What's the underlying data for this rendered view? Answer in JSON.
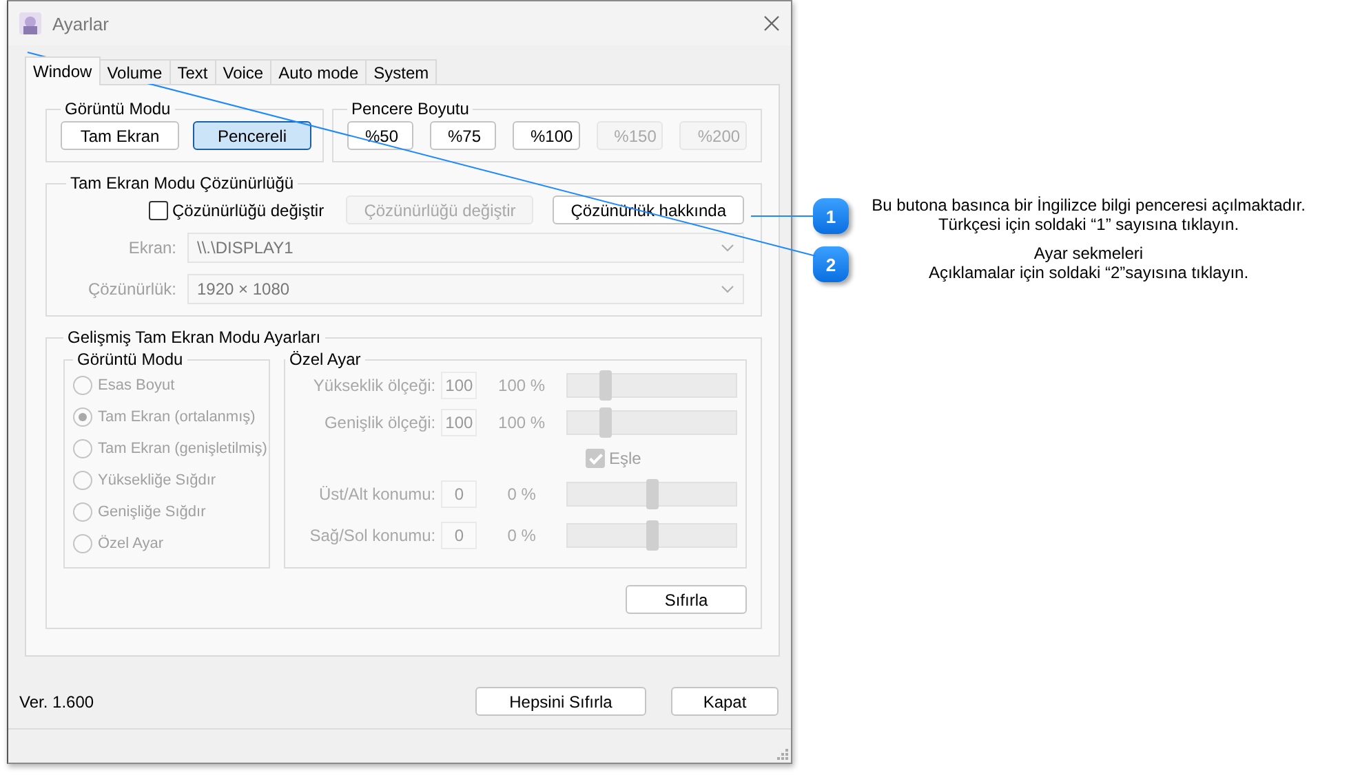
{
  "window": {
    "title": "Ayarlar"
  },
  "tabs": [
    {
      "label": "Window",
      "selected": true
    },
    {
      "label": "Volume",
      "selected": false
    },
    {
      "label": "Text",
      "selected": false
    },
    {
      "label": "Voice",
      "selected": false
    },
    {
      "label": "Auto mode",
      "selected": false
    },
    {
      "label": "System",
      "selected": false
    }
  ],
  "display_mode": {
    "title": "Görüntü Modu",
    "buttons": [
      {
        "label": "Tam Ekran",
        "selected": false
      },
      {
        "label": "Pencereli",
        "selected": true
      }
    ]
  },
  "window_size": {
    "title": "Pencere Boyutu",
    "buttons": [
      {
        "label": "%50",
        "disabled": false
      },
      {
        "label": "%75",
        "disabled": false
      },
      {
        "label": "%100",
        "disabled": false
      },
      {
        "label": "%150",
        "disabled": true
      },
      {
        "label": "%200",
        "disabled": true
      }
    ]
  },
  "fullscreen_resolution": {
    "title": "Tam Ekran Modu Çözünürlüğü",
    "change_checkbox": {
      "label": "Çözünürlüğü değiştir",
      "checked": false
    },
    "change_button": {
      "label": "Çözünürlüğü değiştir",
      "disabled": true
    },
    "about_button": {
      "label": "Çözünürlük hakkında",
      "disabled": false
    },
    "fields": [
      {
        "label": "Ekran:",
        "value": "\\\\.\\DISPLAY1",
        "disabled": true
      },
      {
        "label": "Çözünürlük:",
        "value": "1920 × 1080",
        "disabled": true
      }
    ]
  },
  "advanced": {
    "title": "Gelişmiş Tam Ekran Modu Ayarları",
    "disabled": true,
    "mode_group": {
      "title": "Görüntü Modu",
      "options": [
        {
          "label": "Esas Boyut",
          "selected": false
        },
        {
          "label": "Tam Ekran (ortalanmış)",
          "selected": true
        },
        {
          "label": "Tam Ekran (genişletilmiş)",
          "selected": false
        },
        {
          "label": "Yüksekliğe Sığdır",
          "selected": false
        },
        {
          "label": "Genişliğe Sığdır",
          "selected": false
        },
        {
          "label": "Özel Ayar",
          "selected": false
        }
      ]
    },
    "custom": {
      "title": "Özel Ayar",
      "rows": [
        {
          "kind": "slider",
          "label": "Yükseklik ölçeği:",
          "value": "100",
          "reading": "100 %",
          "level": 0.22
        },
        {
          "kind": "slider",
          "label": "Genişlik ölçeği:",
          "value": "100",
          "reading": "100 %",
          "level": 0.22
        },
        {
          "kind": "checkbox",
          "label": "Eşle",
          "checked": true
        },
        {
          "kind": "slider",
          "label": "Üst/Alt konumu:",
          "value": "0",
          "reading": "0 %",
          "level": 0.5
        },
        {
          "kind": "slider",
          "label": "Sağ/Sol konumu:",
          "value": "0",
          "reading": "0 %",
          "level": 0.5
        }
      ]
    },
    "reset_button": "Sıfırla"
  },
  "version": "Ver. 1.600",
  "footer_buttons": [
    "Hepsini Sıfırla",
    "Kapat"
  ],
  "callouts": [
    {
      "number": "1",
      "lines": [
        "Bu butona basınca bir İngilizce bilgi penceresi açılmaktadır.",
        "Türkçesi için soldaki “1” sayısına tıklayın."
      ]
    },
    {
      "number": "2",
      "lines": [
        "Ayar sekmeleri",
        "Açıklamalar için soldaki “2”sayısına tıklayın."
      ]
    }
  ]
}
